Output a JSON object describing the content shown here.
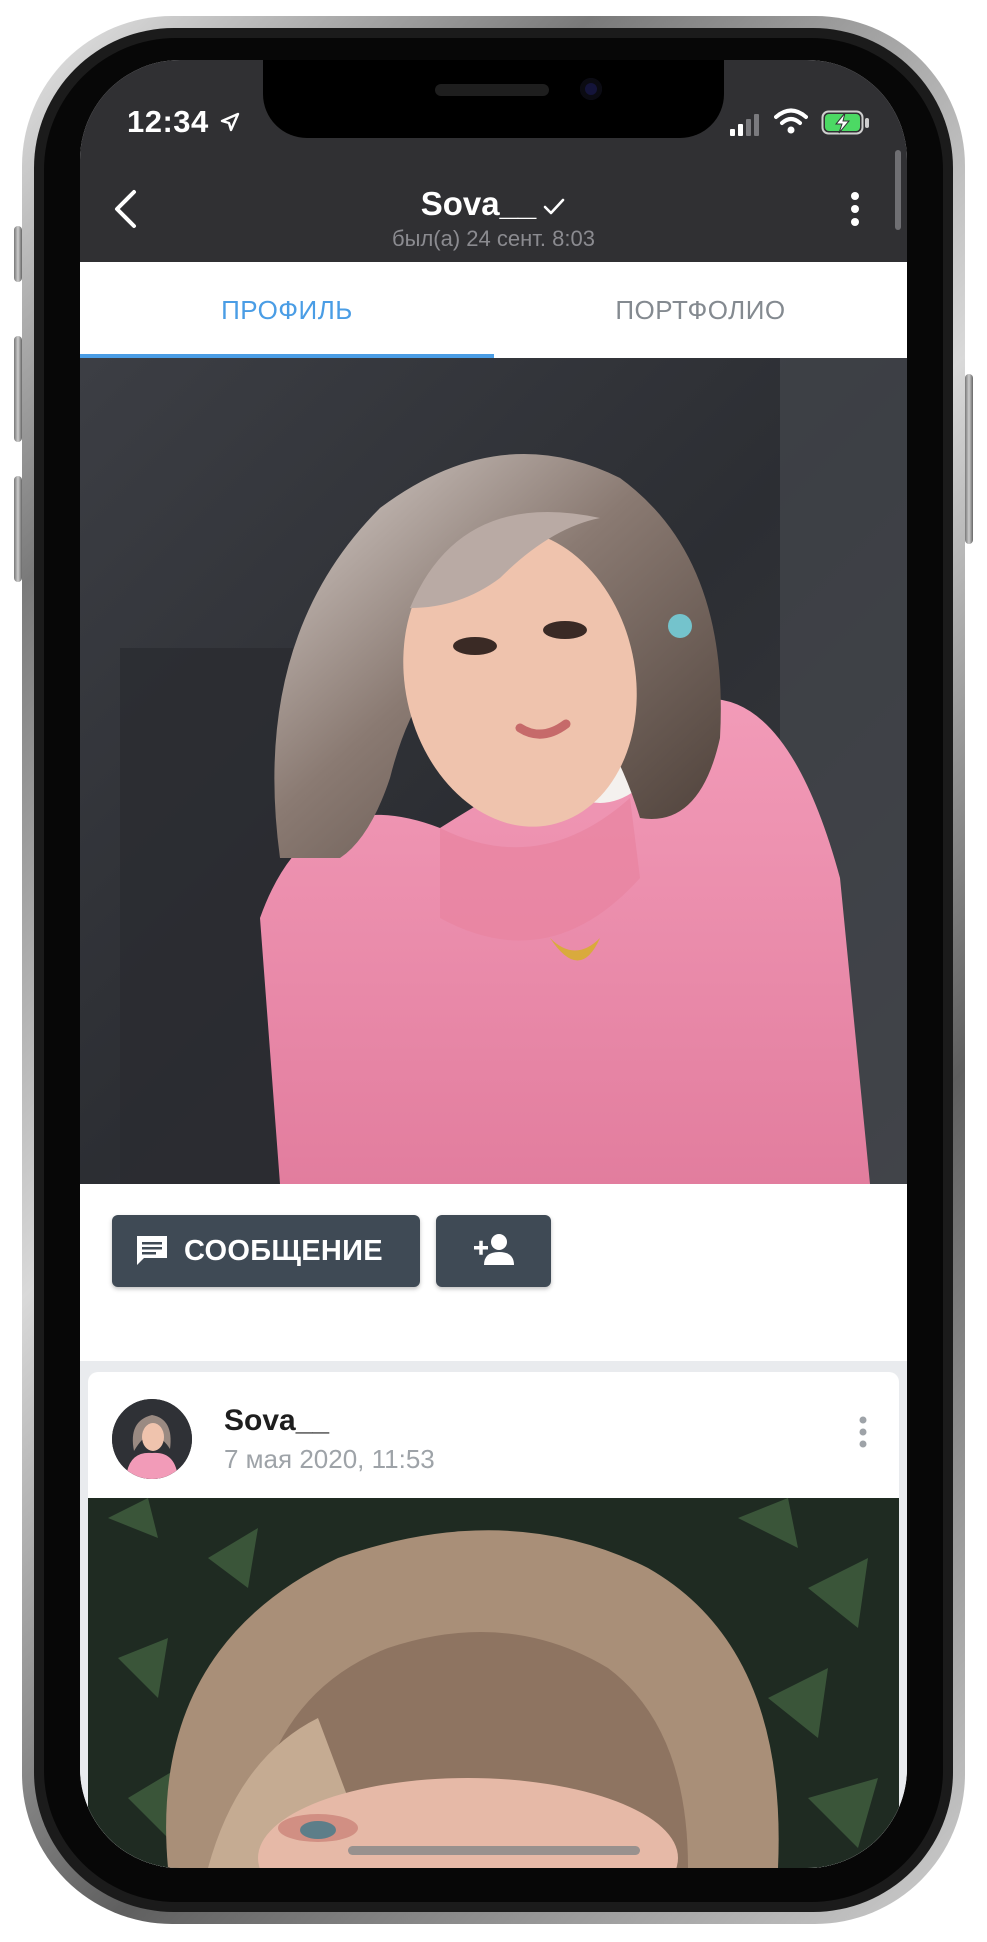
{
  "status_bar": {
    "time": "12:34",
    "icons": [
      "location-arrow-icon",
      "cellular-signal-icon",
      "wifi-icon",
      "battery-charging-icon"
    ]
  },
  "header": {
    "title": "Sova__",
    "verified_icon": "check-icon",
    "subtitle": "был(а) 24 сент. 8:03",
    "back_icon": "chevron-left-icon",
    "menu_icon": "more-vertical-icon"
  },
  "tabs": [
    {
      "label": "ПРОФИЛЬ",
      "active": true
    },
    {
      "label": "ПОРТФОЛИО",
      "active": false
    }
  ],
  "actions": {
    "message_label": "СООБЩЕНИЕ",
    "message_icon": "chat-bubble-icon",
    "add_friend_icon": "person-add-icon"
  },
  "post": {
    "author": "Sova__",
    "date": "7 мая 2020, 11:53",
    "menu_icon": "more-vertical-icon"
  },
  "colors": {
    "header_bg": "#303033",
    "accent": "#4a9de5",
    "button_bg": "#3f4a55",
    "muted_text": "#9ea3a8"
  }
}
